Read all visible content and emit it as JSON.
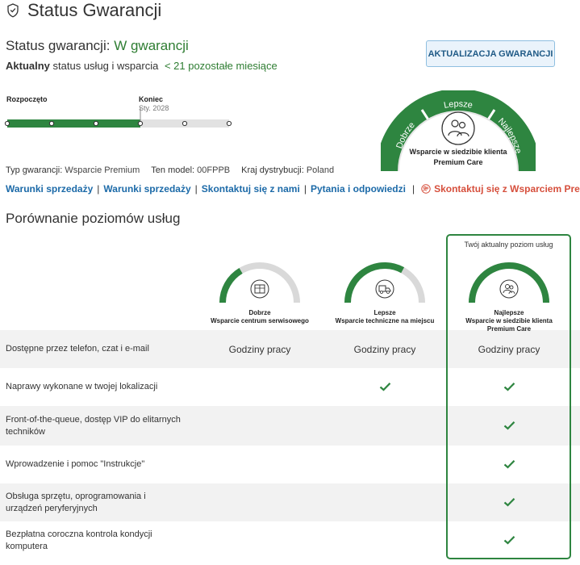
{
  "header": {
    "title": "Status Gwarancji"
  },
  "warranty": {
    "status_label": "Status gwarancji:",
    "status_value": "W gwarancji",
    "current_label": "Aktualny",
    "current_text": "status usług i wsparcia",
    "remaining": "< 21 pozostałe miesiące",
    "update_button": "AKTUALIZACJA GWARANCJI"
  },
  "timeline": {
    "start_label": "Rozpoczęto",
    "end_label": "Koniec",
    "end_date": "Sty. 2028",
    "elapsed_fraction": 0.6
  },
  "current_plan": {
    "tiers": [
      "Dobrze",
      "Lepsze",
      "Najlepsze"
    ],
    "name_line1": "Wsparcie w siedzibie klienta",
    "name_line2": "Premium Care"
  },
  "meta": {
    "type_label": "Typ gwarancji:",
    "type_value": "Wsparcie Premium",
    "model_label": "Ten model:",
    "model_value": "00FPPB",
    "country_label": "Kraj dystrybucji:",
    "country_value": "Poland"
  },
  "links": {
    "items": [
      "Warunki sprzedaży",
      "Warunki sprzedaży",
      "Skontaktuj się z nami",
      "Pytania i odpowiedzi"
    ],
    "premium_contact": "Skontaktuj się z Wsparciem  Premium"
  },
  "comparison": {
    "title": "Porównanie poziomów usług",
    "current_level_label": "Twój aktualny poziom usług",
    "tiers": [
      {
        "level": "Dobrze",
        "name": "Wsparcie centrum serwisowego",
        "fill": 0.33,
        "icon": "box-icon"
      },
      {
        "level": "Lepsze",
        "name": "Wsparcie techniczne na miejscu",
        "fill": 0.66,
        "icon": "truck-icon"
      },
      {
        "level": "Najlepsze",
        "name_line1": "Wsparcie w siedzibie klienta",
        "name_line2": "Premium Care",
        "fill": 1.0,
        "icon": "people-icon"
      }
    ],
    "rows": [
      {
        "feature": "Dostępne przez telefon, czat i e-mail",
        "values": [
          "Godziny pracy",
          "Godziny pracy",
          "Godziny pracy"
        ]
      },
      {
        "feature": "Naprawy wykonane w twojej lokalizacji",
        "values": [
          false,
          true,
          true
        ]
      },
      {
        "feature_line1": "Front-of-the-queue, dostęp VIP do elitarnych",
        "feature_line2": "techników",
        "values": [
          false,
          false,
          true
        ]
      },
      {
        "feature": "Wprowadzenie i pomoc \"Instrukcje\"",
        "values": [
          false,
          false,
          true
        ]
      },
      {
        "feature_line1": "Obsługa sprzętu, oprogramowania i",
        "feature_line2": "urządzeń peryferyjnych",
        "values": [
          false,
          false,
          true
        ]
      },
      {
        "feature_line1": "Bezpłatna coroczna kontrola kondycji",
        "feature_line2": "komputera",
        "values": [
          false,
          false,
          true
        ]
      }
    ]
  },
  "colors": {
    "green": "#2e8540",
    "link_blue": "#1c6aa8",
    "premium_red": "#d64f3c"
  }
}
